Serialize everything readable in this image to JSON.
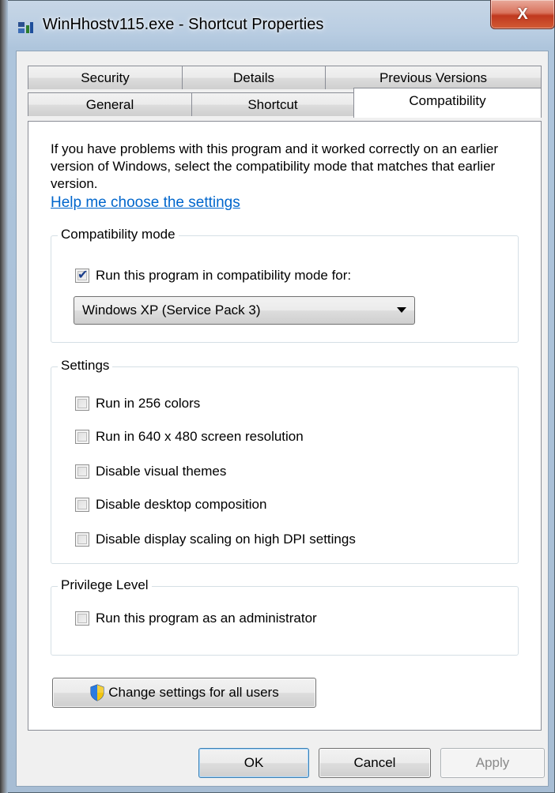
{
  "window": {
    "title": "WinHhostv115.exe - Shortcut Properties",
    "close_label": "X"
  },
  "tabs": {
    "row1": [
      {
        "label": "Security"
      },
      {
        "label": "Details"
      },
      {
        "label": "Previous Versions"
      }
    ],
    "row2": [
      {
        "label": "General"
      },
      {
        "label": "Shortcut"
      },
      {
        "label": "Compatibility",
        "active": true
      }
    ]
  },
  "intro_text": "If you have problems with this program and it worked correctly on an earlier version of Windows, select the compatibility mode that matches that earlier version.",
  "help_link": "Help me choose the settings",
  "compat_mode": {
    "label": "Compatibility mode",
    "run_compat_label": "Run this program in compatibility mode for:",
    "run_compat_checked": true,
    "selected_os": "Windows XP (Service Pack 3)"
  },
  "settings": {
    "label": "Settings",
    "items": [
      {
        "label": "Run in 256 colors",
        "checked": false
      },
      {
        "label": "Run in 640 x 480 screen resolution",
        "checked": false
      },
      {
        "label": "Disable visual themes",
        "checked": false
      },
      {
        "label": "Disable desktop composition",
        "checked": false
      },
      {
        "label": "Disable display scaling on high DPI settings",
        "checked": false
      }
    ]
  },
  "privilege": {
    "label": "Privilege Level",
    "run_admin_label": "Run this program as an administrator",
    "run_admin_checked": false
  },
  "change_all_users_label": "Change settings for all users",
  "buttons": {
    "ok": "OK",
    "cancel": "Cancel",
    "apply": "Apply"
  },
  "colors": {
    "link": "#0066cc",
    "close_red": "#c0391f",
    "frame": "#b9cde2"
  }
}
